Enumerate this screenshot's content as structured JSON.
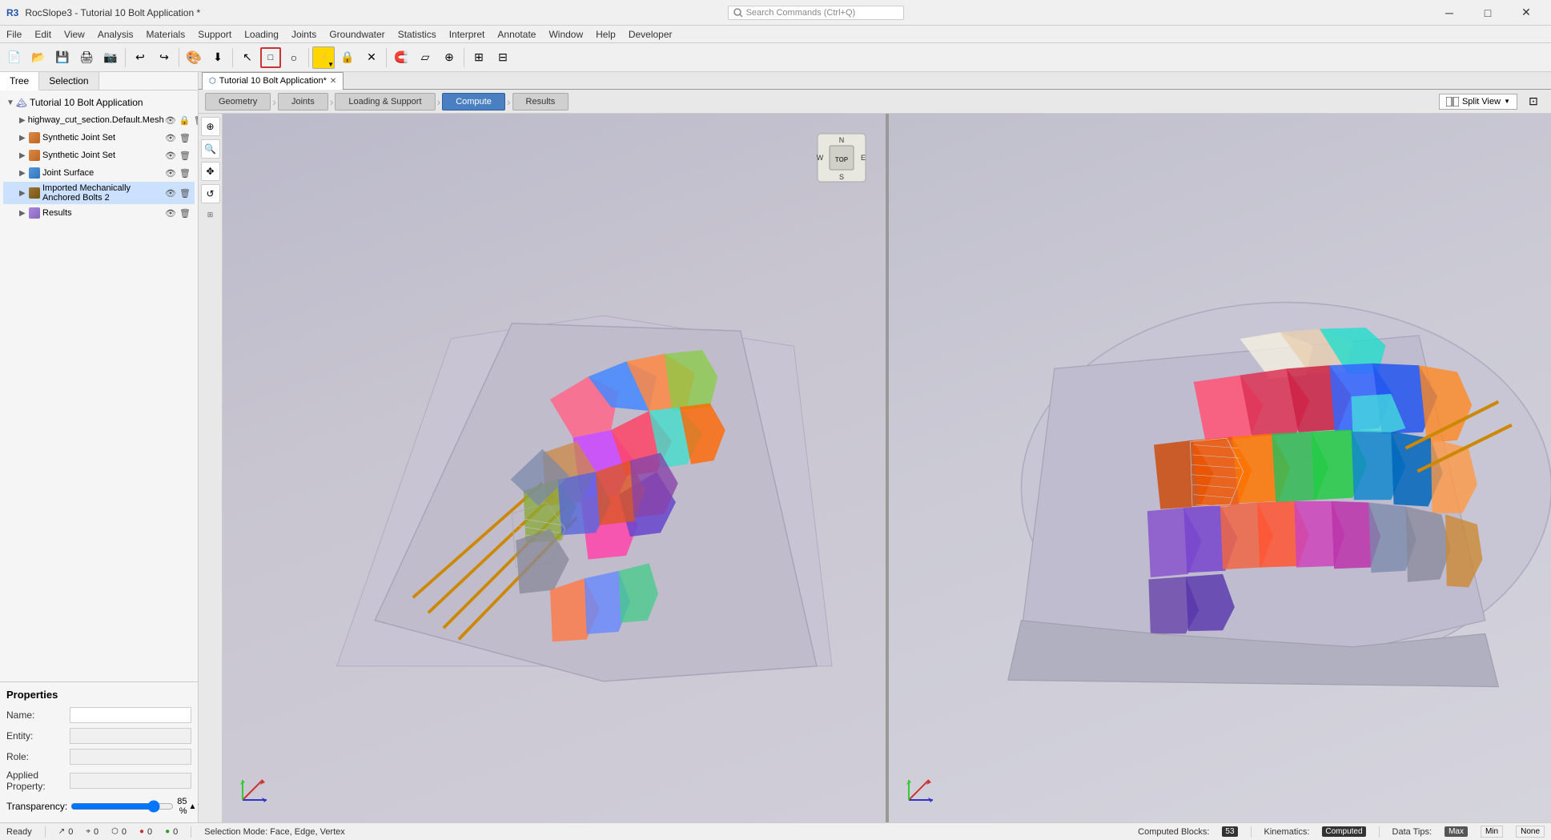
{
  "app": {
    "title": "RocSlope3 - Tutorial 10 Bolt Application *",
    "search_placeholder": "Search Commands (Ctrl+Q)"
  },
  "menu": {
    "items": [
      "File",
      "Edit",
      "View",
      "Analysis",
      "Materials",
      "Support",
      "Loading",
      "Joints",
      "Groundwater",
      "Statistics",
      "Interpret",
      "Annotate",
      "Window",
      "Help",
      "Developer"
    ]
  },
  "tabs": {
    "active": "Tutorial 10 Bolt Application*",
    "items": [
      "Tutorial 10 Bolt Application*"
    ]
  },
  "workflow": {
    "steps": [
      "Geometry",
      "Joints",
      "Loading & Support",
      "Compute",
      "Results"
    ],
    "active": "Compute"
  },
  "sidebar": {
    "tabs": [
      "Tree",
      "Selection"
    ],
    "active_tab": "Tree",
    "tree_root": "Tutorial 10 Bolt Application",
    "items": [
      {
        "id": "mesh",
        "label": "highway_cut_section.Default.Mesh",
        "icon": "mesh",
        "expanded": false,
        "visible": true,
        "locked": true
      },
      {
        "id": "joint1",
        "label": "Synthetic Joint Set",
        "icon": "joint",
        "expanded": false,
        "visible": true,
        "locked": false
      },
      {
        "id": "joint2",
        "label": "Synthetic Joint Set",
        "icon": "joint",
        "expanded": false,
        "visible": true,
        "locked": false
      },
      {
        "id": "surface",
        "label": "Joint Surface",
        "icon": "surface",
        "expanded": false,
        "visible": true,
        "locked": false
      },
      {
        "id": "bolts",
        "label": "Imported Mechanically Anchored Bolts 2",
        "icon": "bolt",
        "expanded": false,
        "visible": true,
        "locked": false
      },
      {
        "id": "results",
        "label": "Results",
        "icon": "results",
        "expanded": false,
        "visible": true,
        "locked": false
      }
    ]
  },
  "properties": {
    "title": "Properties",
    "fields": [
      {
        "label": "Name:",
        "value": "",
        "key": "name"
      },
      {
        "label": "Entity:",
        "value": "",
        "key": "entity"
      },
      {
        "label": "Role:",
        "value": "",
        "key": "role"
      },
      {
        "label": "Applied Property:",
        "value": "",
        "key": "applied_property"
      }
    ],
    "transparency_label": "Transparency:",
    "transparency_value": "85 %",
    "transparency_percent": 85
  },
  "split_view": {
    "label": "Split View"
  },
  "statusbar": {
    "ready": "Ready",
    "selection_mode": "Selection Mode: Face, Edge, Vertex",
    "computed_blocks_label": "Computed Blocks:",
    "computed_blocks_value": "53",
    "kinematics_label": "Kinematics:",
    "kinematics_value": "Computed",
    "data_tips_label": "Data Tips:",
    "data_tips_options": [
      "Max",
      "Min",
      "None"
    ],
    "data_tips_active": "Max",
    "counters": [
      {
        "icon": "pointer",
        "value": "0"
      },
      {
        "icon": "cursor",
        "value": "0"
      },
      {
        "icon": "poly",
        "value": "0"
      },
      {
        "icon": "dot-red",
        "value": "0"
      },
      {
        "icon": "dot-green",
        "value": "0"
      }
    ]
  },
  "compass": {
    "N": "N",
    "S": "S",
    "E": "E",
    "W": "W",
    "TOP": "TOP"
  }
}
